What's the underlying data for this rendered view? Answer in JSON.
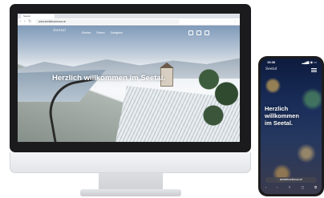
{
  "desktop": {
    "browser": {
      "tab_title": "Seetal",
      "url": "www.seetaltourismus.ch"
    },
    "site": {
      "logo": "Seetal",
      "nav": [
        "Erleben",
        "Planen",
        "Gastgeber"
      ],
      "hero_title": "Herzlich willkommen im Seetal."
    }
  },
  "phone": {
    "time": "15:36",
    "status_icons": "▂▄▆ ◉ ▭",
    "logo": "Seetal",
    "hero_title": "Herzlich willkommen im Seetal.",
    "url": "seetaltourismus.ch",
    "bottom_icons": [
      "‹",
      "›",
      "⇪",
      "▢",
      "⧉"
    ]
  }
}
